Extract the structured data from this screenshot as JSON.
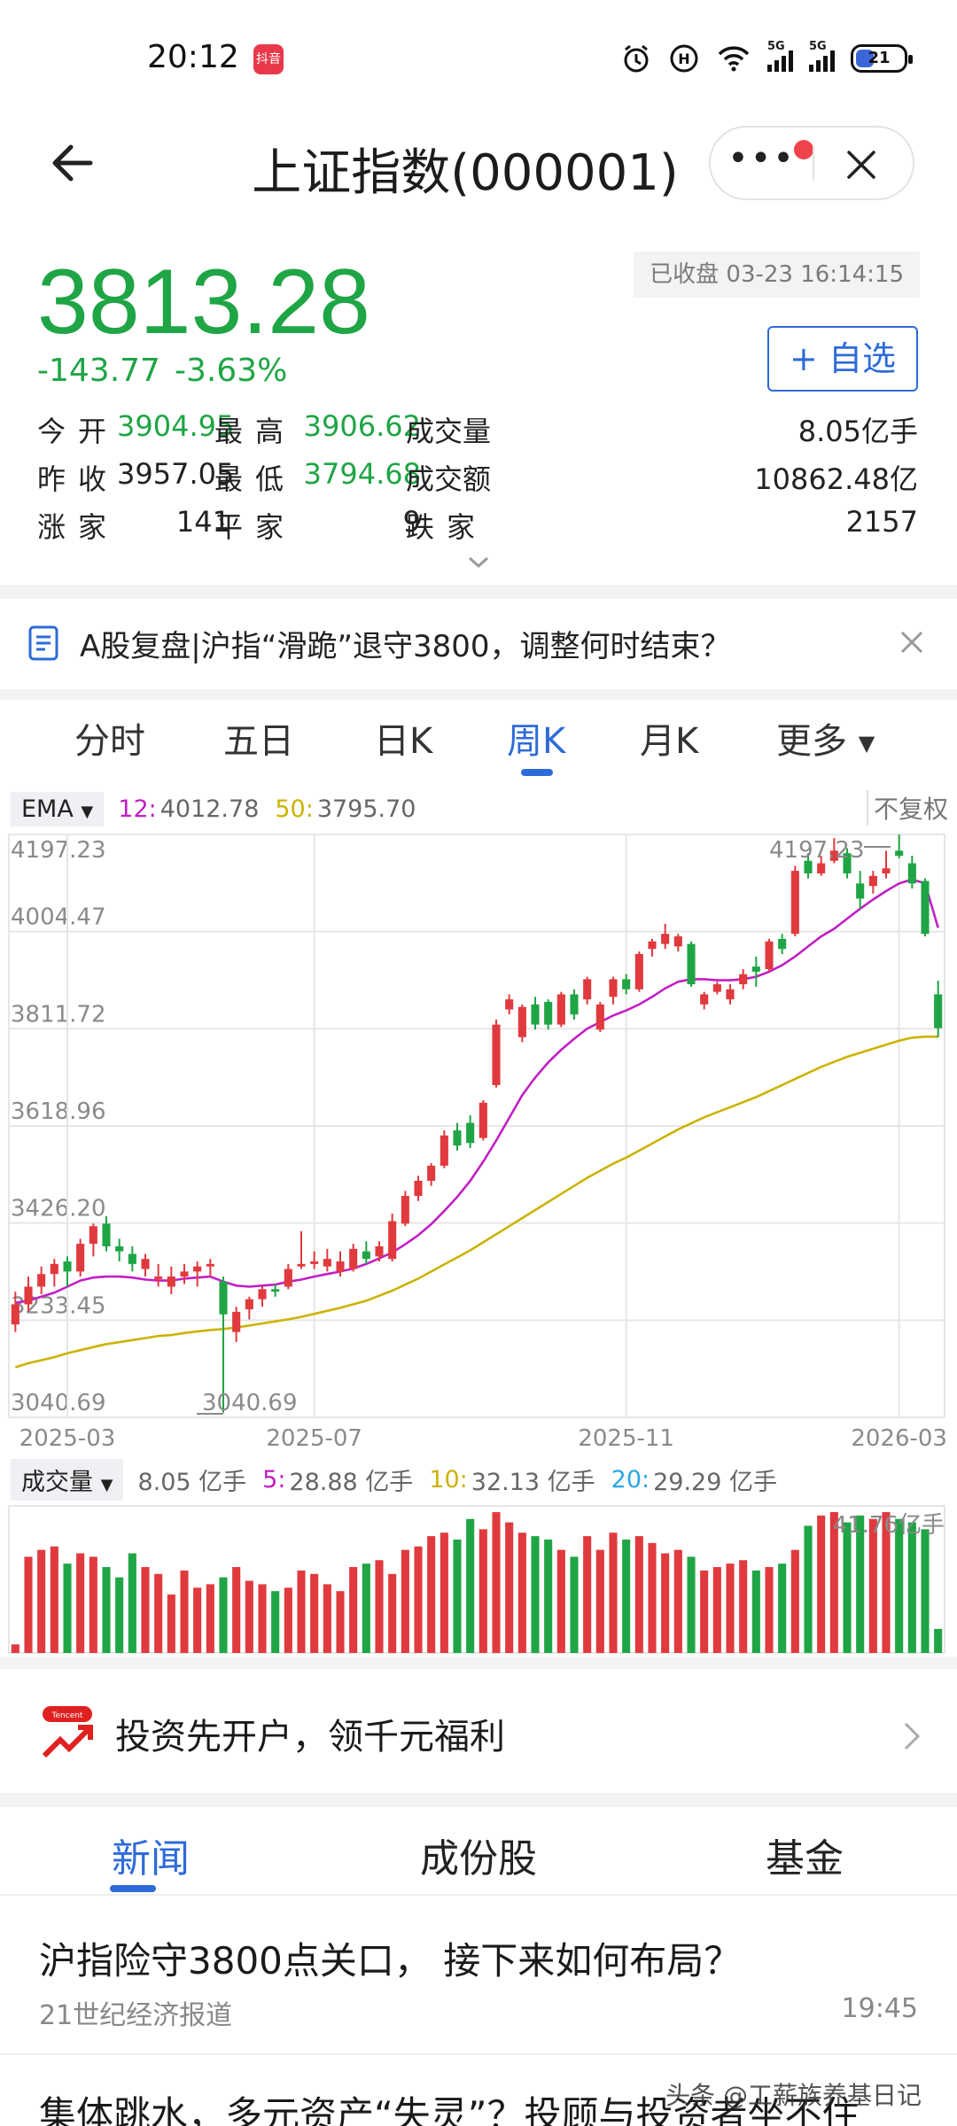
{
  "status": {
    "time": "20:12",
    "app_badge": "抖音",
    "battery": "21",
    "signal_label": "5G"
  },
  "nav": {
    "title": "上证指数(000001)"
  },
  "quote": {
    "price": "3813.28",
    "change": "-143.77",
    "change_pct": "-3.63%",
    "status": "已收盘 03-23 16:14:15",
    "watch_label": "+ 自选",
    "stats": [
      [
        {
          "label": "今开",
          "value": "3904.95"
        },
        {
          "label": "最高",
          "value": "3906.62"
        },
        {
          "label": "成交量",
          "value": "8.05亿手"
        }
      ],
      [
        {
          "label": "昨收",
          "value": "3957.05"
        },
        {
          "label": "最低",
          "value": "3794.68"
        },
        {
          "label": "成交额",
          "value": "10862.48亿"
        }
      ],
      [
        {
          "label": "涨家",
          "value": "141"
        },
        {
          "label": "平家",
          "value": "9"
        },
        {
          "label": "跌家",
          "value": "2157"
        }
      ]
    ]
  },
  "banner": {
    "text": "A股复盘|沪指“滑跪”退守3800，调整何时结束？"
  },
  "chart_tabs": [
    "分时",
    "五日",
    "日K",
    "周K",
    "月K",
    "更多"
  ],
  "chart_tab_active": "周K",
  "ema": {
    "select": "EMA",
    "k1": "12:",
    "v1": "4012.78",
    "k2": "50:",
    "v2": "3795.70",
    "fq": "不复权"
  },
  "vol": {
    "select": "成交量",
    "v0": "8.05 亿手",
    "k5": "5:",
    "v5": "28.88 亿手",
    "k10": "10:",
    "v10": "32.13 亿手",
    "k20": "20:",
    "v20": "29.29 亿手"
  },
  "colors": {
    "up": "#e03a3e",
    "down": "#1fa545",
    "ema12": "#c21fc4",
    "ema50": "#cbb300",
    "accent": "#2d6bd8"
  },
  "chart_data": {
    "type": "candlestick",
    "price_ticks": [
      "4197.23",
      "4004.47",
      "3811.72",
      "3618.96",
      "3426.20",
      "3233.45",
      "3040.69"
    ],
    "ylim": [
      3040.69,
      4197.23
    ],
    "x_ticks": [
      "2025-03",
      "2025-07",
      "2025-11",
      "2026-03"
    ],
    "high_label": "4197.23",
    "low_label": "3040.69",
    "volume_max_label": "41.76亿手",
    "volume_max": 41.76,
    "candles": [
      [
        3225,
        3265,
        3290,
        3210
      ],
      [
        3265,
        3300,
        3320,
        3250
      ],
      [
        3300,
        3325,
        3340,
        3285
      ],
      [
        3325,
        3345,
        3355,
        3300
      ],
      [
        3350,
        3330,
        3360,
        3300
      ],
      [
        3330,
        3385,
        3395,
        3320
      ],
      [
        3385,
        3420,
        3425,
        3360
      ],
      [
        3425,
        3380,
        3440,
        3370
      ],
      [
        3380,
        3370,
        3395,
        3350
      ],
      [
        3365,
        3345,
        3380,
        3330
      ],
      [
        3335,
        3355,
        3365,
        3320
      ],
      [
        3315,
        3320,
        3345,
        3300
      ],
      [
        3300,
        3320,
        3340,
        3285
      ],
      [
        3320,
        3330,
        3345,
        3305
      ],
      [
        3330,
        3340,
        3350,
        3300
      ],
      [
        3340,
        3345,
        3355,
        3320
      ],
      [
        3310,
        3245,
        3320,
        3050
      ],
      [
        3210,
        3250,
        3260,
        3190
      ],
      [
        3255,
        3275,
        3280,
        3235
      ],
      [
        3275,
        3295,
        3300,
        3260
      ],
      [
        3295,
        3290,
        3305,
        3280
      ],
      [
        3300,
        3335,
        3345,
        3295
      ],
      [
        3340,
        3345,
        3410,
        3335
      ],
      [
        3345,
        3350,
        3370,
        3335
      ],
      [
        3340,
        3355,
        3375,
        3330
      ],
      [
        3330,
        3350,
        3370,
        3320
      ],
      [
        3335,
        3375,
        3385,
        3330
      ],
      [
        3370,
        3355,
        3390,
        3345
      ],
      [
        3360,
        3380,
        3390,
        3350
      ],
      [
        3355,
        3430,
        3445,
        3350
      ],
      [
        3425,
        3480,
        3490,
        3420
      ],
      [
        3480,
        3510,
        3520,
        3470
      ],
      [
        3510,
        3540,
        3545,
        3500
      ],
      [
        3540,
        3600,
        3610,
        3535
      ],
      [
        3610,
        3580,
        3625,
        3570
      ],
      [
        3625,
        3585,
        3640,
        3575
      ],
      [
        3595,
        3665,
        3670,
        3590
      ],
      [
        3700,
        3820,
        3830,
        3695
      ],
      [
        3850,
        3870,
        3880,
        3840
      ],
      [
        3795,
        3855,
        3860,
        3785
      ],
      [
        3860,
        3820,
        3875,
        3810
      ],
      [
        3865,
        3820,
        3870,
        3810
      ],
      [
        3820,
        3880,
        3885,
        3815
      ],
      [
        3880,
        3840,
        3890,
        3830
      ],
      [
        3870,
        3910,
        3915,
        3860
      ],
      [
        3810,
        3860,
        3865,
        3805
      ],
      [
        3875,
        3910,
        3915,
        3860
      ],
      [
        3910,
        3890,
        3920,
        3880
      ],
      [
        3890,
        3960,
        3965,
        3885
      ],
      [
        3970,
        3985,
        3990,
        3955
      ],
      [
        3980,
        4000,
        4020,
        3970
      ],
      [
        3975,
        3995,
        4000,
        3965
      ],
      [
        3980,
        3900,
        3985,
        3895
      ],
      [
        3860,
        3880,
        3885,
        3850
      ],
      [
        3885,
        3900,
        3905,
        3880
      ],
      [
        3870,
        3890,
        3900,
        3860
      ],
      [
        3900,
        3920,
        3930,
        3890
      ],
      [
        3935,
        3925,
        3955,
        3895
      ],
      [
        3930,
        3985,
        3990,
        3925
      ],
      [
        3990,
        3970,
        4000,
        3960
      ],
      [
        4000,
        4125,
        4135,
        3995
      ],
      [
        4145,
        4120,
        4160,
        4110
      ],
      [
        4120,
        4140,
        4155,
        4115
      ],
      [
        4145,
        4165,
        4190,
        4140
      ],
      [
        4160,
        4120,
        4170,
        4110
      ],
      [
        4100,
        4070,
        4125,
        4050
      ],
      [
        4095,
        4115,
        4125,
        4080
      ],
      [
        4120,
        4130,
        4165,
        4110
      ],
      [
        4165,
        4155,
        4197,
        4150
      ],
      [
        4140,
        4100,
        4155,
        4090
      ],
      [
        4105,
        4000,
        4110,
        3995
      ],
      [
        3880,
        3813,
        3907,
        3795
      ]
    ],
    "volumes": [
      2.5,
      28,
      30,
      31,
      26,
      29,
      28,
      25,
      22,
      29,
      25,
      23,
      17,
      24,
      19,
      20,
      22,
      25,
      21,
      20,
      18,
      19,
      24,
      23,
      20,
      18,
      25,
      26,
      27,
      23,
      30,
      31,
      34,
      35,
      33,
      39,
      36,
      41,
      38,
      35,
      34,
      33,
      30,
      28,
      34,
      30,
      35,
      33,
      34,
      32,
      29,
      30,
      28,
      24,
      25,
      26,
      27,
      24,
      25,
      26,
      30,
      37,
      40,
      41,
      38,
      40,
      39,
      41,
      39,
      38,
      36,
      7
    ],
    "ema12": [
      3268,
      3272,
      3280,
      3288,
      3300,
      3312,
      3318,
      3320,
      3320,
      3318,
      3314,
      3312,
      3312,
      3316,
      3318,
      3320,
      3310,
      3302,
      3300,
      3302,
      3304,
      3310,
      3314,
      3320,
      3325,
      3330,
      3336,
      3345,
      3356,
      3368,
      3384,
      3402,
      3424,
      3450,
      3478,
      3510,
      3548,
      3590,
      3635,
      3680,
      3715,
      3745,
      3770,
      3792,
      3812,
      3825,
      3838,
      3848,
      3860,
      3875,
      3892,
      3905,
      3910,
      3910,
      3908,
      3908,
      3910,
      3915,
      3925,
      3938,
      3955,
      3975,
      3995,
      4010,
      4030,
      4050,
      4068,
      4085,
      4100,
      4108,
      4100,
      4012
    ],
    "ema50": [
      3140,
      3148,
      3154,
      3160,
      3168,
      3174,
      3180,
      3186,
      3190,
      3194,
      3198,
      3202,
      3204,
      3208,
      3211,
      3214,
      3216,
      3219,
      3223,
      3227,
      3231,
      3235,
      3240,
      3246,
      3252,
      3258,
      3265,
      3272,
      3282,
      3292,
      3304,
      3316,
      3330,
      3344,
      3358,
      3372,
      3388,
      3404,
      3420,
      3436,
      3452,
      3468,
      3484,
      3500,
      3516,
      3530,
      3544,
      3556,
      3570,
      3584,
      3598,
      3612,
      3624,
      3636,
      3646,
      3656,
      3666,
      3676,
      3688,
      3700,
      3712,
      3724,
      3736,
      3746,
      3756,
      3764,
      3772,
      3780,
      3788,
      3794,
      3796,
      3796
    ]
  },
  "promo": {
    "text": "投资先开户，领千元福利"
  },
  "news_tabs": [
    "新闻",
    "成份股",
    "基金"
  ],
  "news": [
    {
      "title": "沪指险守3800点关口， 接下来如何布局？",
      "source": "21世纪经济报道",
      "time": "19:45"
    },
    {
      "title": "集体跳水，多元资产“失灵”？投顾与投资者坐不住",
      "source": "",
      "time": ""
    }
  ],
  "watermark": "头条 @工薪族养基日记"
}
